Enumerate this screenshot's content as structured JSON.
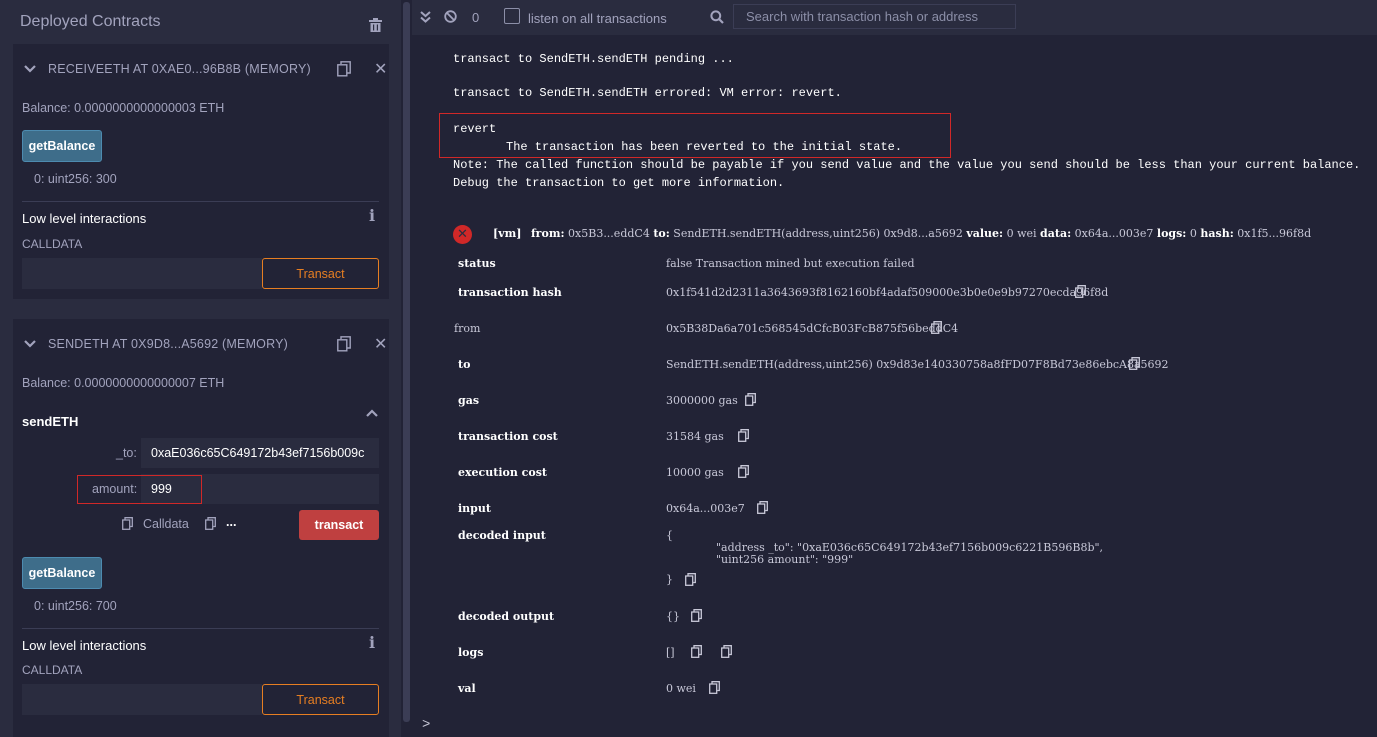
{
  "left": {
    "title": "Deployed Contracts",
    "contracts": [
      {
        "name": "RECEIVEETH AT 0XAE0...96B8B (MEMORY)",
        "balance": "Balance: 0.0000000000000003 ETH",
        "get_balance_label": "getBalance",
        "get_balance_output": "0: uint256: 300",
        "low_level_title": "Low level interactions",
        "calldata_label": "CALLDATA",
        "transact_label": "Transact"
      },
      {
        "name": "SENDETH AT 0X9D8...A5692 (MEMORY)",
        "balance": "Balance: 0.0000000000000007 ETH",
        "function_name": "sendETH",
        "param_to_label": "_to:",
        "param_to_value": "0xaE036c65C649172b43ef7156b009c",
        "param_amount_label": "amount:",
        "param_amount_value": "999",
        "calldata_copy_label": "Calldata",
        "ellipsis": "...",
        "transact_button_label": "transact",
        "get_balance_label": "getBalance",
        "get_balance_output": "0: uint256: 700",
        "low_level_title": "Low level interactions",
        "calldata_label": "CALLDATA",
        "transact_label": "Transact"
      }
    ]
  },
  "terminal": {
    "counter": "0",
    "listen_label": "listen on all transactions",
    "search_placeholder": "Search with transaction hash or address",
    "lines": {
      "pending": "transact to SendETH.sendETH pending ...",
      "errored": "transact to SendETH.sendETH errored: VM error: revert.",
      "revert": "revert",
      "revert_msg": "The transaction has been reverted to the initial state.",
      "note": "Note: The called function should be payable if you send value and the value you send should be less than your current balance.",
      "debug": "Debug the transaction to get more information."
    },
    "summary": {
      "vm": "[vm]",
      "from_k": "from:",
      "from_v": "0x5B3...eddC4",
      "to_k": "to:",
      "to_v": "SendETH.sendETH(address,uint256) 0x9d8...a5692",
      "value_k": "value:",
      "value_v": "0 wei",
      "data_k": "data:",
      "data_v": "0x64a...003e7",
      "logs_k": "logs:",
      "logs_v": "0",
      "hash_k": "hash:",
      "hash_v": "0x1f5...96f8d"
    },
    "rows": {
      "status_k": "status",
      "status_v": "false Transaction mined but execution failed",
      "txhash_k": "transaction hash",
      "txhash_v": "0x1f541d2d2311a3643693f8162160bf4adaf509000e3b0e0e9b97270ecda96f8d",
      "from_k": "from",
      "from_v": "0x5B38Da6a701c568545dCfcB03FcB875f56beddC4",
      "to_k": "to",
      "to_v": "SendETH.sendETH(address,uint256) 0x9d83e140330758a8fFD07F8Bd73e86ebcA8a5692",
      "gas_k": "gas",
      "gas_v": "3000000 gas",
      "txcost_k": "transaction cost",
      "txcost_v": "31584 gas",
      "execcost_k": "execution cost",
      "execcost_v": "10000 gas",
      "input_k": "input",
      "input_v": "0x64a...003e7",
      "decin_k": "decoded input",
      "decin_open": "{",
      "decin_l1": "\"address _to\": \"0xaE036c65C649172b43ef7156b009c6221B596B8b\",",
      "decin_l2": "\"uint256 amount\": \"999\"",
      "decin_close": "}",
      "decout_k": "decoded output",
      "decout_v": "{}",
      "logs_k": "logs",
      "logs_v": "[]",
      "val_k": "val",
      "val_v": "0 wei"
    },
    "prompt": ">"
  }
}
